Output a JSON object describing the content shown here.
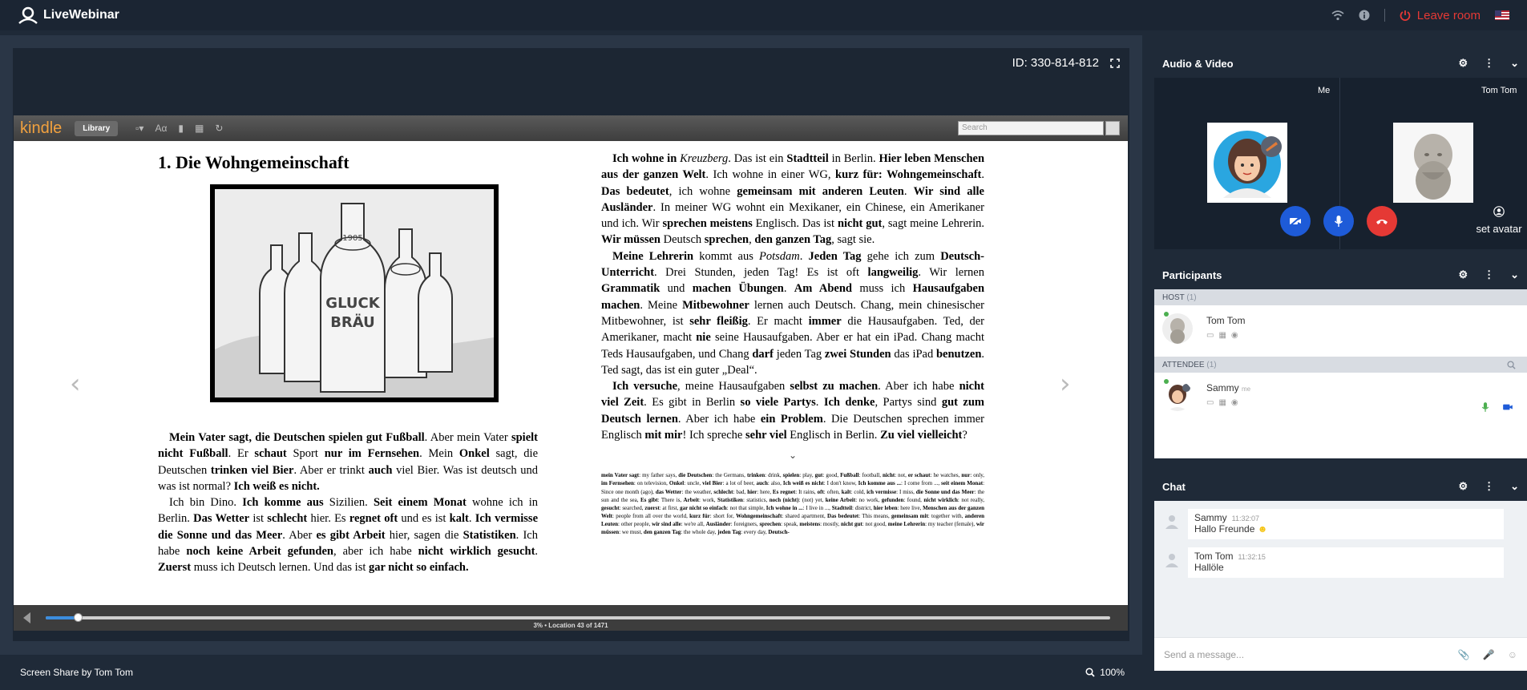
{
  "topbar": {
    "brand": "LiveWebinar",
    "leave_label": "Leave room"
  },
  "stage": {
    "room_id": "ID: 330-814-812",
    "screen_share_label": "Screen Share by Tom Tom",
    "zoom_level": "100%"
  },
  "kindle": {
    "logo": "kindle",
    "library_label": "Library",
    "search_placeholder": "Search",
    "chapter_title": "1. Die Wohngemeinschaft",
    "location_text": "3% • Location 43 of 1471",
    "progress_percent": 3,
    "illustration_labels": [
      "GLUCK",
      "BRÄU",
      "1905"
    ]
  },
  "audio_video": {
    "title": "Audio & Video",
    "me_label": "Me",
    "other_label": "Tom Tom",
    "set_avatar_label": "set avatar"
  },
  "participants": {
    "title": "Participants",
    "host_group": "HOST",
    "host_count": "(1)",
    "attendee_group": "ATTENDEE",
    "attendee_count": "(1)",
    "host_name": "Tom Tom",
    "attendee_name": "Sammy",
    "attendee_tag": "me"
  },
  "chat": {
    "title": "Chat",
    "messages": [
      {
        "author": "Sammy",
        "time": "11:32:07",
        "text": "Hallo Freunde"
      },
      {
        "author": "Tom Tom",
        "time": "11:32:15",
        "text": "Hallöle"
      }
    ],
    "input_placeholder": "Send a message..."
  },
  "colors": {
    "leave": "#e53935",
    "accent_blue": "#1e5bd8",
    "hangup_red": "#e53935",
    "progress_blue": "#3c8dde",
    "online_green": "#4caf50"
  }
}
